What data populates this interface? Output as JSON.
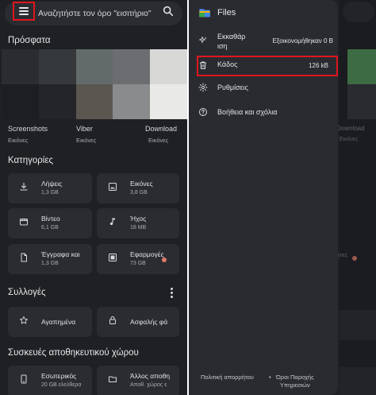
{
  "left": {
    "search_placeholder": "Αναζητήστε τον όρο \"εισιτήριο\"",
    "recent_title": "Πρόσφατα",
    "recent_tiles": [
      "#2b2c30",
      "#36393b",
      "#626b6a",
      "#6b6d70",
      "#d8d9d6",
      "#1d1e21",
      "#242528",
      "#5b5650",
      "#8a8b8c",
      "#e9e9e7"
    ],
    "recent_folders": [
      {
        "name": "Screenshots",
        "sub": "Εικόνες"
      },
      {
        "name": "Viber",
        "sub": "Εικόνες"
      },
      {
        "name": "Download",
        "sub": "Εικόνες"
      }
    ],
    "categories_title": "Κατηγορίες",
    "categories": [
      {
        "icon": "download-icon",
        "label": "Λήψεις",
        "size": "1,3 GB"
      },
      {
        "icon": "image-icon",
        "label": "Εικόνες",
        "size": "3,8 GB"
      },
      {
        "icon": "video-icon",
        "label": "Βίντεο",
        "size": "6,1 GB"
      },
      {
        "icon": "music-note-icon",
        "label": "Ήχος",
        "size": "18 MB"
      },
      {
        "icon": "document-icon",
        "label": "Έγγραφα και",
        "size": "1,3 GB"
      },
      {
        "icon": "apps-icon",
        "label": "Εφαρμογές",
        "size": "73 GB"
      }
    ],
    "collections_title": "Συλλογές",
    "collections": [
      {
        "icon": "star-icon",
        "label": "Αγαπημένα"
      },
      {
        "icon": "lock-icon",
        "label": "Ασφαλής φά"
      }
    ],
    "storage_title": "Συσκευές αποθηκευτικού χώρου",
    "storage": [
      {
        "icon": "phone-icon",
        "label": "Εσωτερικός",
        "sub": "20 GB ελεύθερα"
      },
      {
        "icon": "folder-icon",
        "label": "Άλλος αποθη",
        "sub": "Αποθ. χώρος ε"
      }
    ],
    "accent_red": "#e0161e"
  },
  "drawer": {
    "app_title": "Files",
    "items": [
      {
        "icon": "sparkle-icon",
        "label": "Εκκαθάρ ιση",
        "line1": "Εκκαθάρ",
        "line2": "ιση",
        "value": "Εξοικονομήθηκαν 0 B"
      },
      {
        "icon": "trash-icon",
        "label": "Κάδος",
        "value": "126 kB"
      },
      {
        "icon": "gear-icon",
        "label": "Ρυθμίσεις"
      },
      {
        "icon": "help-icon",
        "label": "Βοήθεια και σχόλια"
      }
    ],
    "footer": {
      "privacy": "Πολιτική απορρήτου",
      "separator": "•",
      "terms_line1": "Όροι Παροχής",
      "terms_line2": "Υπηρεσιών"
    },
    "background_peek": [
      "Download",
      "Εικόνες",
      "σιες"
    ]
  }
}
